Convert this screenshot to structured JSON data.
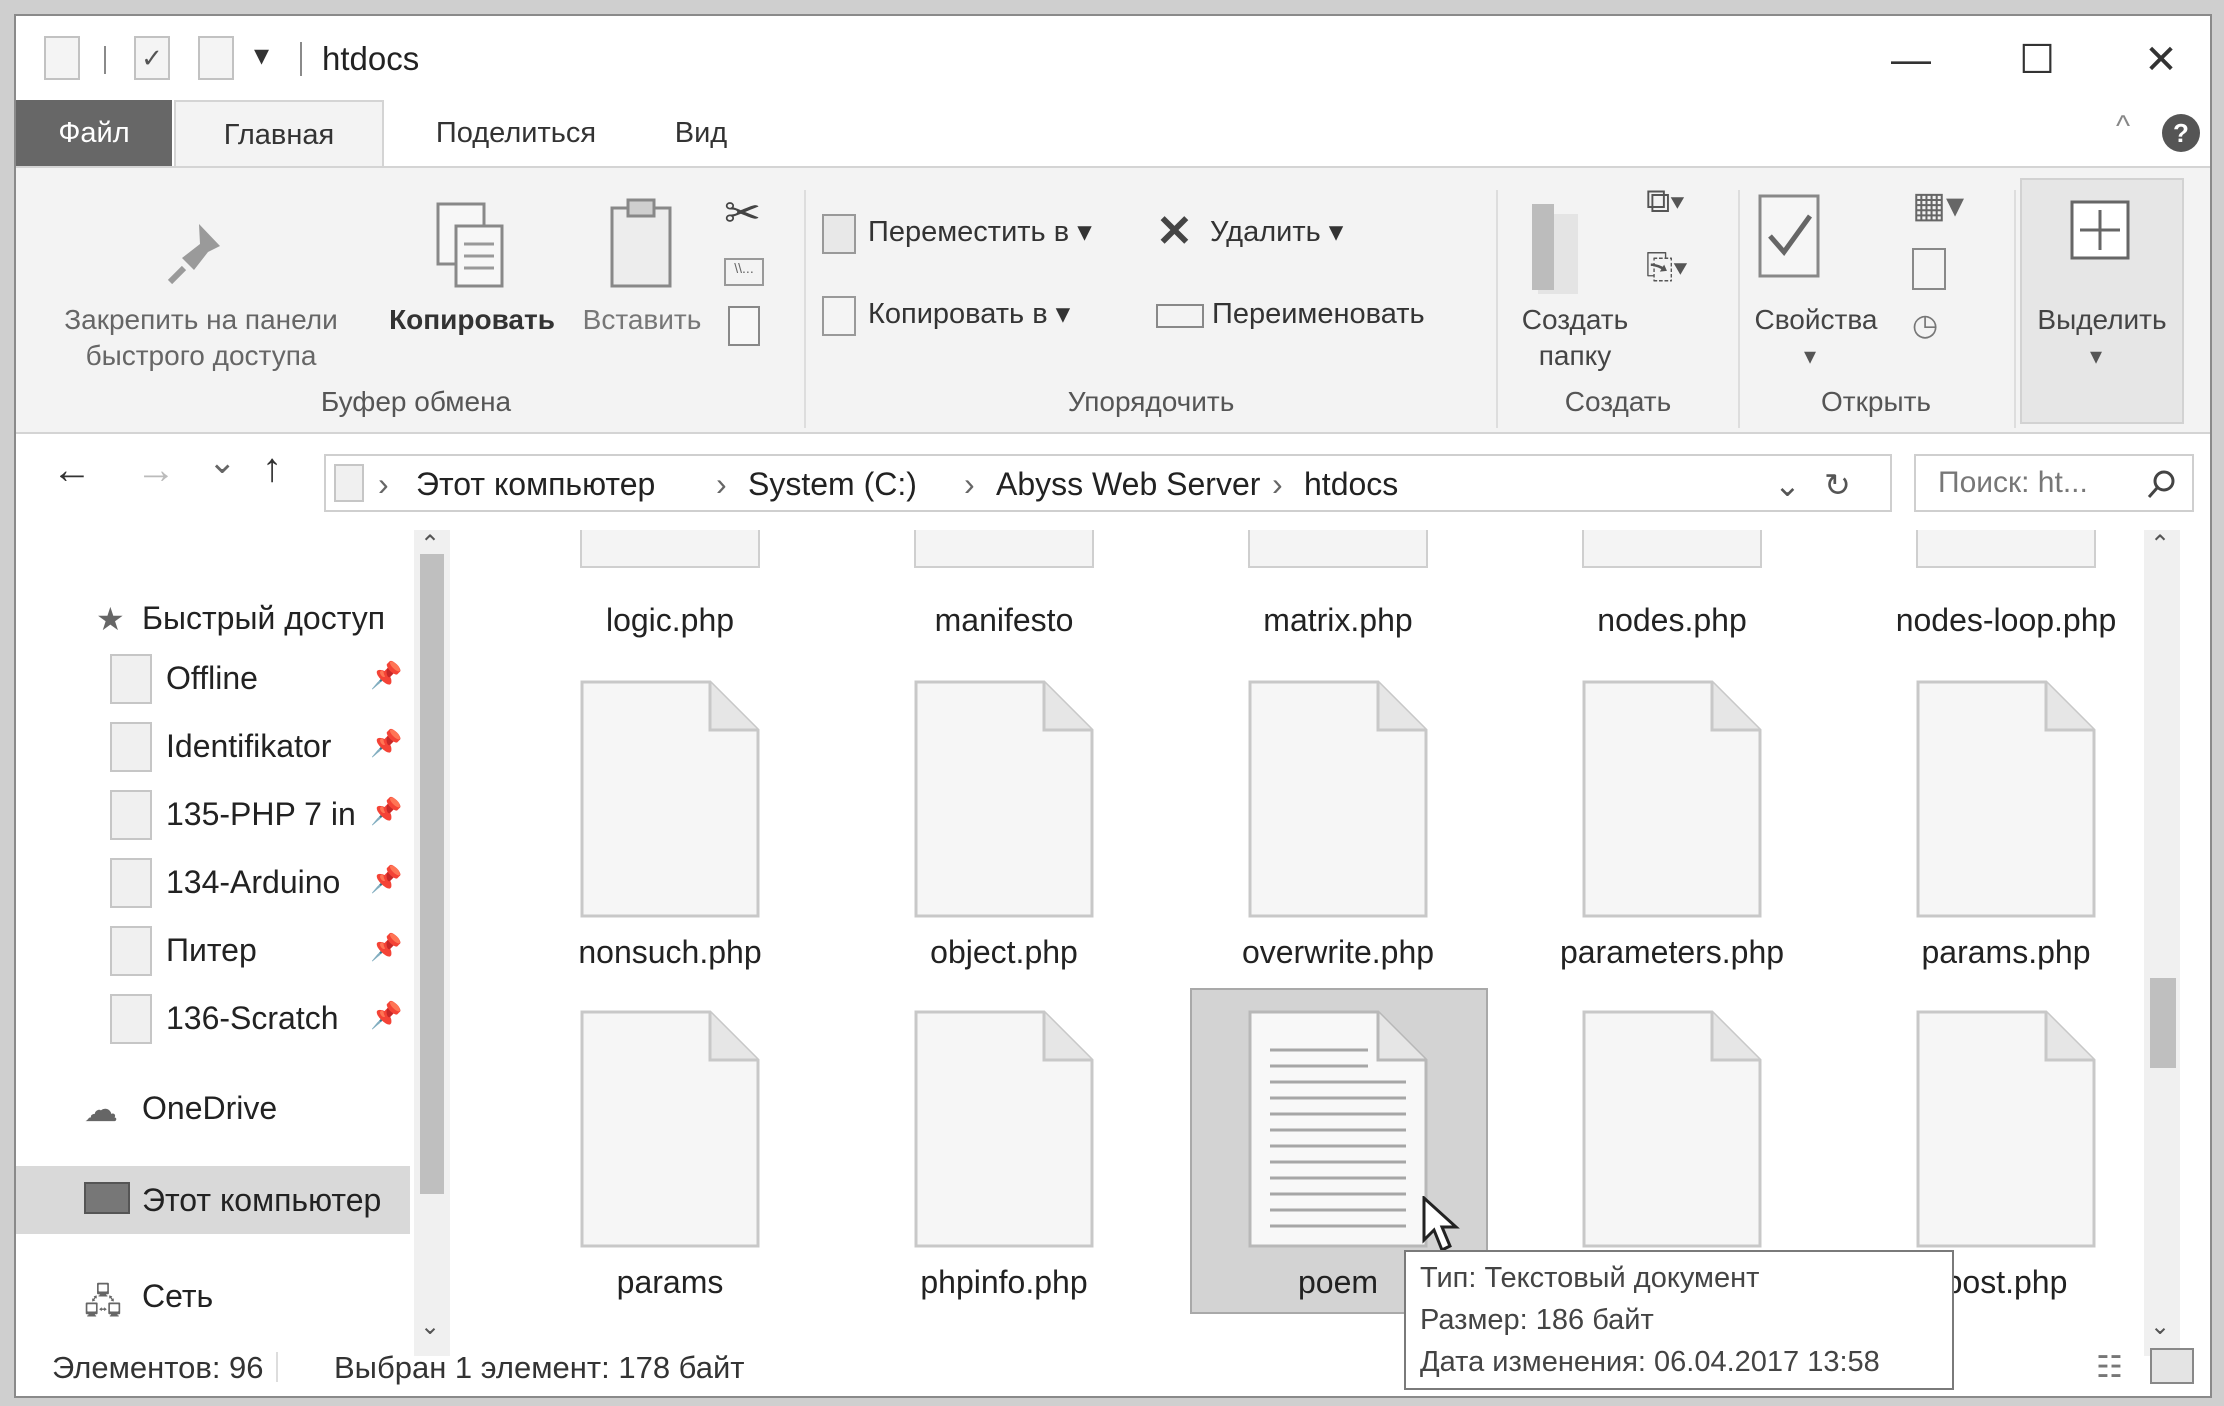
{
  "window": {
    "title": "htdocs",
    "minimize": "—",
    "maximize": "☐",
    "close": "✕"
  },
  "qat": {
    "dropdown": "▾"
  },
  "tabs": [
    {
      "label": "Файл"
    },
    {
      "label": "Главная"
    },
    {
      "label": "Поделиться"
    },
    {
      "label": "Вид"
    }
  ],
  "ribbon": {
    "pin_label": "Закрепить на панели\nбыстрого доступа",
    "copy_label": "Копировать",
    "paste_label": "Вставить",
    "clipboard_group": "Буфер обмена",
    "move_to": "Переместить в ▾",
    "copy_to": "Копировать в ▾",
    "delete": "Удалить ▾",
    "rename": "Переименовать",
    "organize_group": "Упорядочить",
    "new_folder": "Создать\nпапку",
    "create_group": "Создать",
    "properties": "Свойства",
    "open_group": "Открыть",
    "select": "Выделить",
    "dropdown_arrow": "▾",
    "help": "?"
  },
  "nav": {
    "back": "←",
    "forward": "→",
    "recent": "⌄",
    "up": "↑",
    "crumbs": [
      "Этот компьютер",
      "System (C:)",
      "Abyss Web Server",
      "htdocs"
    ],
    "chevron": "›",
    "refresh": "↻",
    "search_placeholder": "Поиск: ht..."
  },
  "sidebar": {
    "quick_access": "Быстрый доступ",
    "pinned": [
      "Offline",
      "Identifikator",
      "135-PHP 7 in",
      "134-Arduino",
      "Питер",
      "136-Scratch"
    ],
    "onedrive": "OneDrive",
    "this_pc": "Этот компьютер",
    "network": "Сеть"
  },
  "files": {
    "row0": [
      "logic.php",
      "manifesto",
      "matrix.php",
      "nodes.php",
      "nodes-loop.php"
    ],
    "row1": [
      "nonsuch.php",
      "object.php",
      "overwrite.php",
      "parameters.php",
      "params.php"
    ],
    "row2": [
      "params",
      "phpinfo.php",
      "poem",
      "",
      "post.php"
    ]
  },
  "tooltip": {
    "type": "Тип: Текстовый документ",
    "size": "Размер: 186 байт",
    "date": "Дата изменения: 06.04.2017 13:58"
  },
  "status": {
    "count": "Элементов: 96",
    "selected": "Выбран 1 элемент: 178 байт"
  }
}
